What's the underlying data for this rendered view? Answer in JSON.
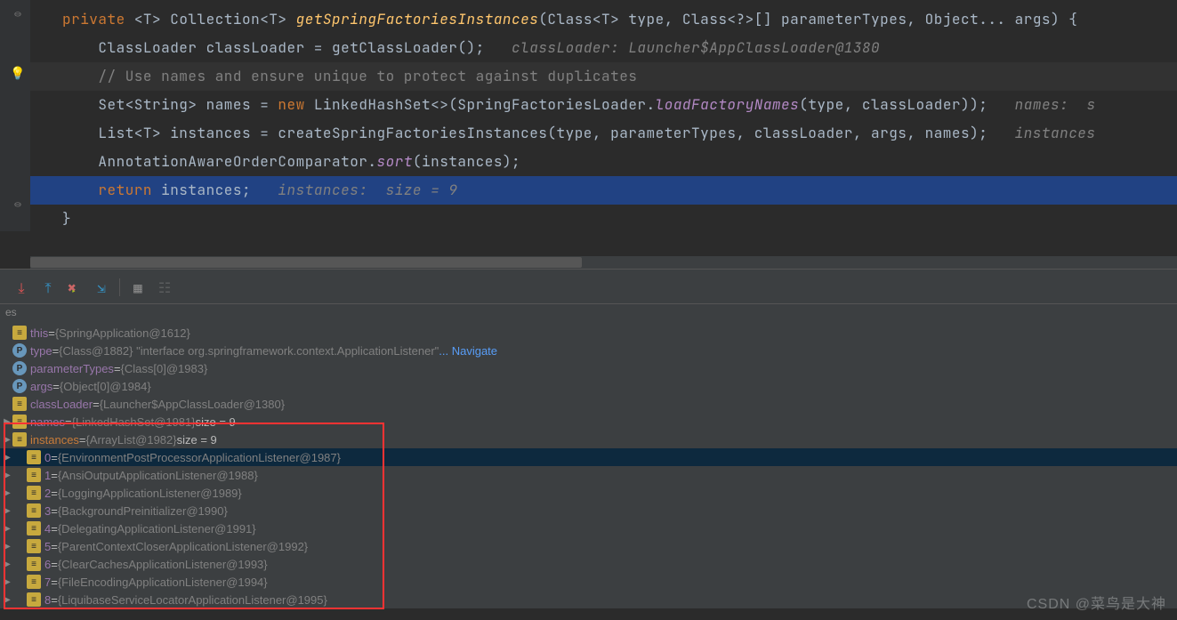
{
  "code": {
    "line1": {
      "kw1": "private ",
      "gen": "<T> Collection<T> ",
      "method": "getSpringFactoriesInstances",
      "rest": "(Class<T> type, Class<?>[] parameterTypes, Object... args) {"
    },
    "line2": {
      "text": "    ClassLoader classLoader = getClassLoader();   ",
      "hint": "classLoader: Launcher$AppClassLoader@1380"
    },
    "line3": {
      "comment": "    // Use names and ensure unique to protect against duplicates"
    },
    "line4": {
      "a": "    Set<String> names = ",
      "kw": "new ",
      "b": "LinkedHashSet<>(SpringFactoriesLoader.",
      "m": "loadFactoryNames",
      "c": "(type, classLoader));   ",
      "hint": "names:  s"
    },
    "line5": {
      "text": "    List<T> instances = createSpringFactoriesInstances(type, parameterTypes, classLoader, args, names);   ",
      "hint": "instances"
    },
    "line6": {
      "a": "    AnnotationAwareOrderComparator.",
      "m": "sort",
      "b": "(instances);"
    },
    "line7": {
      "kw": "    return ",
      "a": "instances;   ",
      "hint": "instances:  size = 9"
    },
    "line8": {
      "text": "}"
    }
  },
  "vars_tab": "es",
  "vars": [
    {
      "icon": "f",
      "indent": 0,
      "arrow": false,
      "name": "this",
      "sep": " = ",
      "val": "{SpringApplication@1612}",
      "sel": false
    },
    {
      "icon": "p",
      "indent": 0,
      "arrow": false,
      "name": "type",
      "sep": " = ",
      "val": "{Class@1882} \"interface org.springframework.context.ApplicationListener\"",
      "link": " ... Navigate",
      "sel": false
    },
    {
      "icon": "p",
      "indent": 0,
      "arrow": false,
      "name": "parameterTypes",
      "sep": " = ",
      "val": "{Class[0]@1983}",
      "sel": false
    },
    {
      "icon": "p",
      "indent": 0,
      "arrow": false,
      "name": "args",
      "sep": " = ",
      "val": "{Object[0]@1984}",
      "sel": false
    },
    {
      "icon": "f",
      "indent": 0,
      "arrow": false,
      "name": "classLoader",
      "sep": " = ",
      "val": "{Launcher$AppClassLoader@1380}",
      "sel": false
    },
    {
      "icon": "f",
      "indent": 0,
      "arrow": true,
      "name": "names",
      "sep": " = ",
      "val": "{LinkedHashSet@1981}",
      "extra": "  size = 9",
      "sel": false
    },
    {
      "icon": "f",
      "indent": 0,
      "arrow": true,
      "name": "instances",
      "sep": " = ",
      "val": "{ArrayList@1982}",
      "extra": "  size = 9",
      "sel": false,
      "nameSel": true
    },
    {
      "icon": "e",
      "indent": 1,
      "arrow": true,
      "name": "0",
      "sep": " = ",
      "val": "{EnvironmentPostProcessorApplicationListener@1987}",
      "sel": true
    },
    {
      "icon": "e",
      "indent": 1,
      "arrow": true,
      "name": "1",
      "sep": " = ",
      "val": "{AnsiOutputApplicationListener@1988}",
      "sel": false
    },
    {
      "icon": "e",
      "indent": 1,
      "arrow": true,
      "name": "2",
      "sep": " = ",
      "val": "{LoggingApplicationListener@1989}",
      "sel": false
    },
    {
      "icon": "e",
      "indent": 1,
      "arrow": true,
      "name": "3",
      "sep": " = ",
      "val": "{BackgroundPreinitializer@1990}",
      "sel": false
    },
    {
      "icon": "e",
      "indent": 1,
      "arrow": true,
      "name": "4",
      "sep": " = ",
      "val": "{DelegatingApplicationListener@1991}",
      "sel": false
    },
    {
      "icon": "e",
      "indent": 1,
      "arrow": true,
      "name": "5",
      "sep": " = ",
      "val": "{ParentContextCloserApplicationListener@1992}",
      "sel": false
    },
    {
      "icon": "e",
      "indent": 1,
      "arrow": true,
      "name": "6",
      "sep": " = ",
      "val": "{ClearCachesApplicationListener@1993}",
      "sel": false
    },
    {
      "icon": "e",
      "indent": 1,
      "arrow": true,
      "name": "7",
      "sep": " = ",
      "val": "{FileEncodingApplicationListener@1994}",
      "sel": false
    },
    {
      "icon": "e",
      "indent": 1,
      "arrow": true,
      "name": "8",
      "sep": " = ",
      "val": "{LiquibaseServiceLocatorApplicationListener@1995}",
      "sel": false
    }
  ],
  "watermark": "CSDN @菜鸟是大神"
}
